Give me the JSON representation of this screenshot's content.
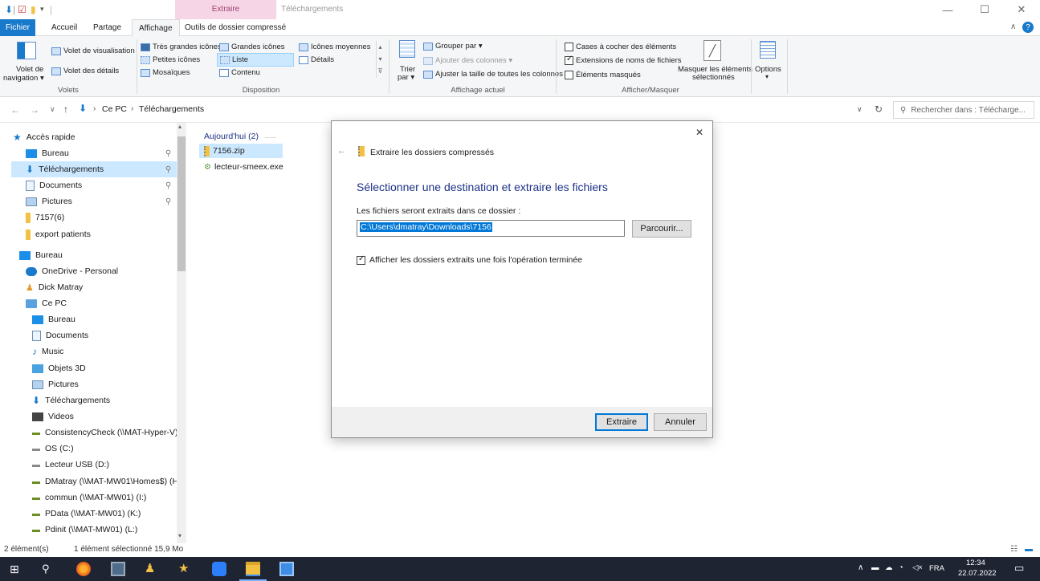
{
  "window": {
    "context_tab_extraire": "Extraire",
    "context_tab_downloads": "Téléchargements",
    "minimize": "—",
    "maximize": "☐",
    "close": "✕"
  },
  "ribbon_tabs": {
    "fichier": "Fichier",
    "accueil": "Accueil",
    "partage": "Partage",
    "affichage": "Affichage",
    "outils": "Outils de dossier compressé"
  },
  "ribbon": {
    "volets": {
      "nav_pane_line1": "Volet de",
      "nav_pane_line2": "navigation ▾",
      "preview_pane": "Volet de visualisation",
      "details_pane": "Volet des détails",
      "group_label": "Volets"
    },
    "disposition": {
      "very_large_icons": "Très grandes icônes",
      "large_icons": "Grandes icônes",
      "medium_icons": "Icônes moyennes",
      "small_icons": "Petites icônes",
      "list": "Liste",
      "details": "Détails",
      "tiles": "Mosaïques",
      "content": "Contenu",
      "group_label": "Disposition"
    },
    "affichage_actuel": {
      "sort_line1": "Trier",
      "sort_line2": "par ▾",
      "group_by": "Grouper par ▾",
      "add_columns": "Ajouter des colonnes ▾",
      "fit_columns": "Ajuster la taille de toutes les colonnes",
      "group_label": "Affichage actuel"
    },
    "afficher_masquer": {
      "item_checkboxes": "Cases à cocher des éléments",
      "file_extensions": "Extensions de noms de fichiers",
      "hidden_items": "Éléments masqués",
      "hide_selected_line1": "Masquer les éléments",
      "hide_selected_line2": "sélectionnés",
      "group_label": "Afficher/Masquer"
    },
    "options": {
      "label": "Options",
      "arrow": "▾"
    }
  },
  "address": {
    "crumb_pc": "Ce PC",
    "crumb_downloads": "Téléchargements",
    "search_placeholder": "Rechercher dans : Télécharge..."
  },
  "nav": {
    "quick_access": "Accès rapide",
    "qa_desktop": "Bureau",
    "qa_downloads": "Téléchargements",
    "qa_documents": "Documents",
    "qa_pictures": "Pictures",
    "qa_7157": "7157(6)",
    "qa_export": "export patients",
    "desktop_root": "Bureau",
    "onedrive": "OneDrive - Personal",
    "user": "Dick Matray",
    "this_pc": "Ce PC",
    "pc_desktop": "Bureau",
    "pc_documents": "Documents",
    "pc_music": "Music",
    "pc_3d": "Objets 3D",
    "pc_pictures": "Pictures",
    "pc_downloads": "Téléchargements",
    "pc_videos": "Videos",
    "drive_consistency": "ConsistencyCheck (\\\\MAT-Hyper-V) (",
    "drive_os": "OS (C:)",
    "drive_usb": "Lecteur USB (D:)",
    "drive_dmatray": "DMatray (\\\\MAT-MW01\\Homes$) (H",
    "drive_commun": "commun (\\\\MAT-MW01) (I:)",
    "drive_pdata": "PData (\\\\MAT-MW01) (K:)",
    "drive_pdinit": "Pdinit (\\\\MAT-MW01) (L:)"
  },
  "files": {
    "group_header": "Aujourd'hui (2)",
    "items": [
      "7156.zip",
      "lecteur-smeex.exe"
    ]
  },
  "dialog": {
    "title": "Extraire les dossiers compressés",
    "heading": "Sélectionner une destination et extraire les fichiers",
    "field_label": "Les fichiers seront extraits dans ce dossier :",
    "path_value": "C:\\Users\\dmatray\\Downloads\\7156",
    "browse": "Parcourir...",
    "show_checkbox": "Afficher les dossiers extraits une fois l'opération terminée",
    "extract": "Extraire",
    "cancel": "Annuler"
  },
  "status": {
    "count": "2 élément(s)",
    "selected": "1 élément sélectionné  15,9 Mo"
  },
  "taskbar": {
    "lang": "FRA",
    "time": "12:34",
    "date": "22.07.2022"
  },
  "colors": {
    "accent": "#1979ca",
    "folder": "#f2c144",
    "selection": "#cce8ff",
    "taskbar": "#1f2433"
  }
}
